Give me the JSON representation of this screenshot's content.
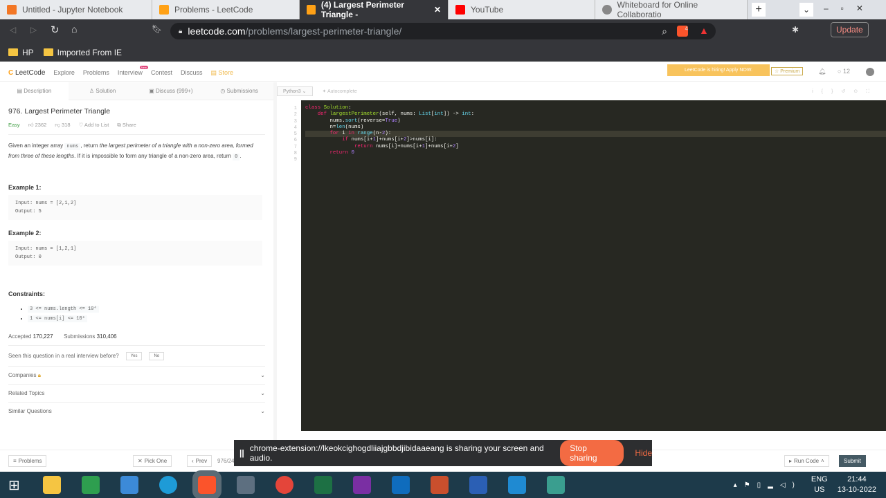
{
  "browser": {
    "tabs": [
      {
        "title": "Untitled - Jupyter Notebook",
        "icon": "jupyter-icon",
        "color": "#f37726"
      },
      {
        "title": "Problems - LeetCode",
        "icon": "leetcode-icon",
        "color": "#ffa116"
      },
      {
        "title": "(4) Largest Perimeter Triangle -",
        "icon": "leetcode-icon",
        "color": "#ffa116",
        "active": true
      },
      {
        "title": "YouTube",
        "icon": "youtube-icon",
        "color": "#ff0000"
      },
      {
        "title": "Whiteboard for Online Collaboratio",
        "icon": "globe-icon",
        "color": "#888888"
      }
    ],
    "url_host": "leetcode.com",
    "url_path": "/problems/largest-perimeter-triangle/",
    "update_label": "Update",
    "brave_badge": "4",
    "bookmarks": [
      "HP",
      "Imported From IE"
    ]
  },
  "nav": {
    "logo": "LeetCode",
    "items": [
      "Explore",
      "Problems",
      "Interview",
      "Contest",
      "Discuss",
      "Store"
    ],
    "new_badge": "New",
    "hiring": "LeetCode is hiring! Apply NOW.",
    "premium": "Premium",
    "coins": "12"
  },
  "problem": {
    "tabs": [
      "Description",
      "Solution",
      "Discuss (999+)",
      "Submissions"
    ],
    "title": "976. Largest Perimeter Triangle",
    "difficulty": "Easy",
    "likes": "2362",
    "dislikes": "318",
    "add_to_list": "Add to List",
    "share": "Share",
    "desc_1": "Given an integer array ",
    "desc_code": "nums",
    "desc_2": ", return ",
    "desc_it": "the largest perimeter of a triangle with a non-zero area, formed from three of these lengths",
    "desc_3": ". If it is impossible to form any triangle of a non-zero area, return ",
    "desc_code2": "0",
    "desc_4": ".",
    "examples": [
      {
        "title": "Example 1:",
        "input": "Input: nums = [2,1,2]",
        "output": "Output: 5"
      },
      {
        "title": "Example 2:",
        "input": "Input: nums = [1,2,1]",
        "output": "Output: 0"
      }
    ],
    "constraints_title": "Constraints:",
    "constraints": [
      "3 <= nums.length <= 10⁴",
      "1 <= nums[i] <= 10⁶"
    ],
    "accepted_label": "Accepted",
    "accepted": "170,227",
    "submissions_label": "Submissions",
    "submissions": "310,406",
    "seen": "Seen this question in a real interview before?",
    "yes": "Yes",
    "no": "No",
    "sections": [
      "Companies",
      "Related Topics",
      "Similar Questions"
    ]
  },
  "editor": {
    "language": "Python3",
    "autocomplete": "Autocomplete",
    "line_numbers": [
      "1",
      "2",
      "3",
      "4",
      "5",
      "6",
      "7",
      "8",
      "9"
    ],
    "code": [
      "class Solution:",
      "    def largestPerimeter(self, nums: List[int]) -> int:",
      "        nums.sort(reverse=True)",
      "        n=len(nums)",
      "        for i in range(n-2):",
      "            if nums[i+1]+nums[i+2]>nums[i]:",
      "                return nums[i]+nums[i+1]+nums[i+2]",
      "        return 0",
      ""
    ]
  },
  "footer": {
    "problems": "Problems",
    "pick_one": "Pick One",
    "prev": "Prev",
    "page": "976/24",
    "run_code": "Run Code",
    "submit": "Submit"
  },
  "sharing": {
    "message": "chrome-extension://lkeokcighogdliiajgbbdjibidaaeang is sharing your screen and audio.",
    "stop": "Stop sharing",
    "hide": "Hide"
  },
  "taskbar": {
    "lang": "ENG",
    "region": "US",
    "time": "21:44",
    "date": "13-10-2022"
  }
}
